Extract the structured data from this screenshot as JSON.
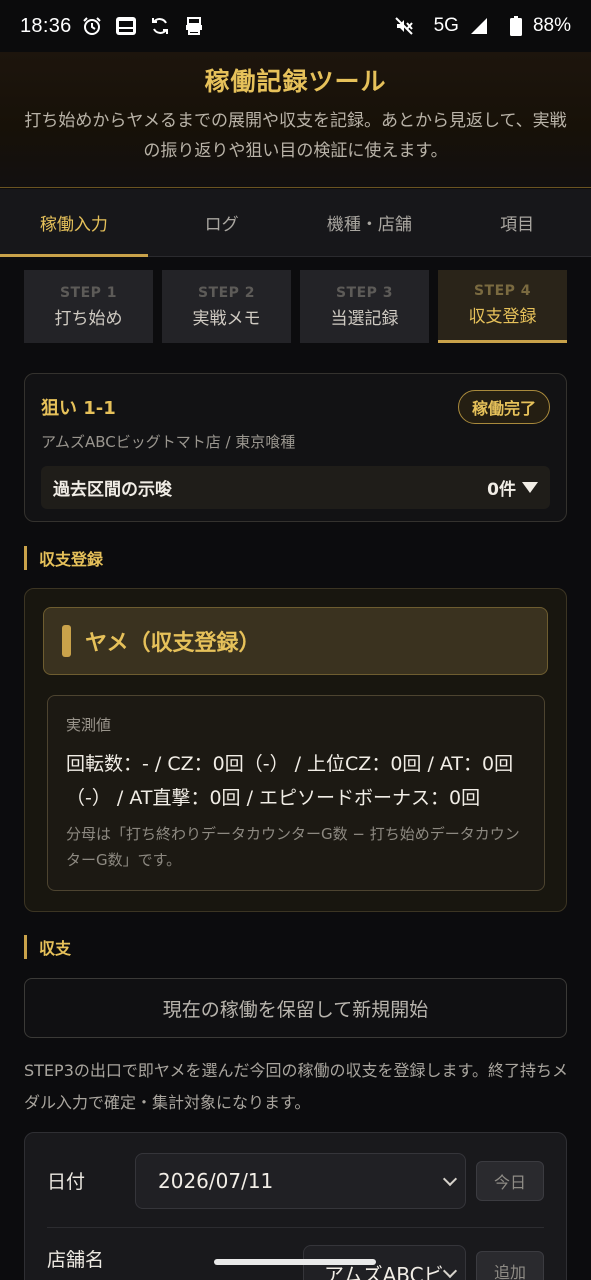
{
  "status_bar": {
    "time": "18:36",
    "network": "5G",
    "battery": "88%",
    "icons": [
      "alarm-icon",
      "news-app-icon",
      "sync-icon",
      "printer-icon",
      "mute-icon",
      "signal-icon",
      "battery-icon"
    ]
  },
  "header": {
    "title": "稼働記録ツール",
    "subtitle": "打ち始めからヤメるまでの展開や収支を記録。あとから見返して、実戦の振り返りや狙い目の検証に使えます。"
  },
  "tabs": [
    {
      "label": "稼働入力",
      "active": true
    },
    {
      "label": "ログ",
      "active": false
    },
    {
      "label": "機種・店舗",
      "active": false
    },
    {
      "label": "項目",
      "active": false
    }
  ],
  "steps": [
    {
      "num": "STEP 1",
      "name": "打ち始め",
      "active": false
    },
    {
      "num": "STEP 2",
      "name": "実戦メモ",
      "active": false
    },
    {
      "num": "STEP 3",
      "name": "当選記録",
      "active": false
    },
    {
      "num": "STEP 4",
      "name": "収支登録",
      "active": true
    }
  ],
  "target": {
    "title": "狙い 1-1",
    "badge": "稼働完了",
    "subtitle": "アムズABCビッグトマト店 / 東京喰種",
    "past_label": "過去区間の示唆",
    "past_count": "0件"
  },
  "income_section": {
    "label": "収支登録",
    "yame_title": "ヤメ（収支登録）",
    "measure_label": "実測値",
    "measure_value": "回転数：- / CZ：0回（-） / 上位CZ：0回 / AT：0回（-） / AT直撃：0回 / エピソードボーナス：0回",
    "measure_note": "分母は「打ち終わりデータカウンターG数 − 打ち始めデータカウンターG数」です。"
  },
  "balance_section": {
    "label": "収支",
    "hold_button": "現在の稼働を保留して新規開始",
    "explain": "STEP3の出口で即ヤメを選んだ今回の稼働の収支を登録します。終了持ちメダル入力で確定・集計対象になります。"
  },
  "form": {
    "date_label": "日付",
    "date_value": "2026/07/11",
    "today_button": "今日",
    "store_label": "店舗名",
    "store_value": "アムズABCビ",
    "add_button": "追加"
  },
  "colors": {
    "accent": "#e6c15a",
    "accent_line": "#c9a24a",
    "background": "#0c0c0e"
  }
}
